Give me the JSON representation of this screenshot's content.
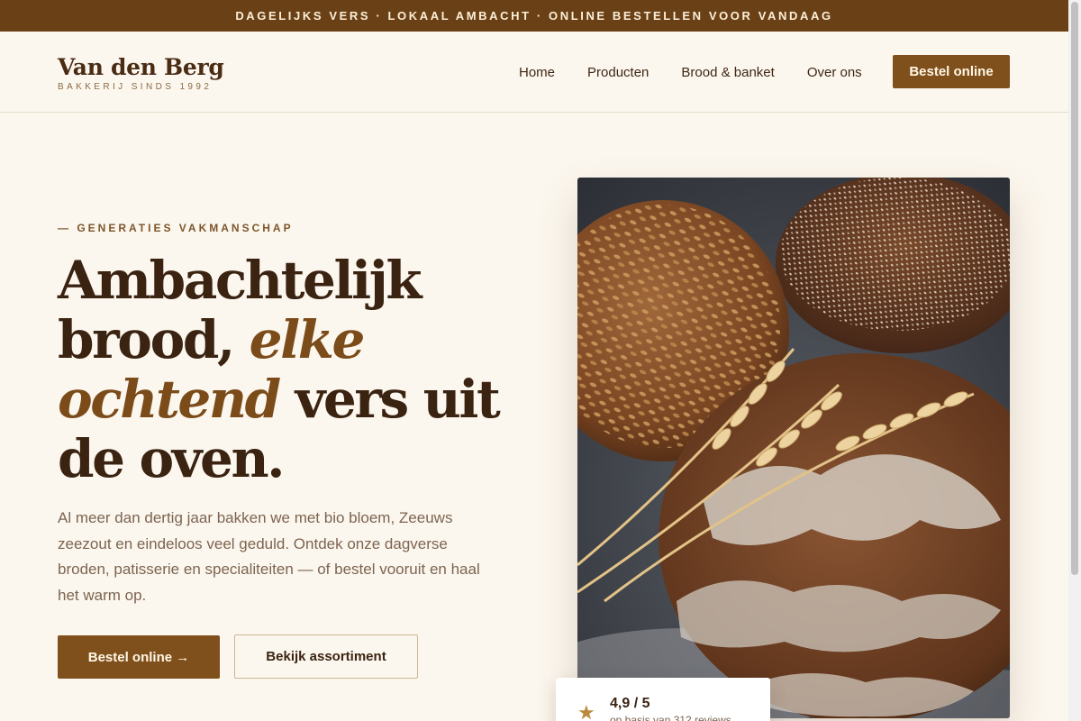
{
  "topbar": {
    "text": "DAGELIJKS VERS · LOKAAL AMBACHT · ONLINE BESTELLEN VOOR VANDAAG"
  },
  "logo": {
    "name": "Van den Berg",
    "subtitle": "BAKKERIJ SINDS 1992"
  },
  "nav": {
    "items": [
      "Home",
      "Producten",
      "Brood & banket",
      "Over ons"
    ],
    "cta": "Bestel online"
  },
  "hero": {
    "eyebrow": "— GENERATIES VAKMANSCHAP",
    "headline": {
      "part1": "Ambachtelijk brood, ",
      "accent1": "elke",
      "accent2": "ochtend",
      "part2": " vers uit de oven."
    },
    "lede": "Al meer dan dertig jaar bakken we met bio bloem, Zeeuws zeezout en eindeloos veel geduld. Ontdek onze dagverse broden, patisserie en specialiteiten — of bestel vooruit en haal het warm op.",
    "primary_button": "Bestel online →",
    "secondary_button": "Bekijk assortiment"
  },
  "rating": {
    "star_icon": "star-icon",
    "value": "4,9 / 5",
    "note": "op basis van 312 reviews"
  },
  "colors": {
    "brand_dark": "#6a4117",
    "brand": "#80501c",
    "background": "#fcf7ee",
    "heading": "#3b2312"
  }
}
